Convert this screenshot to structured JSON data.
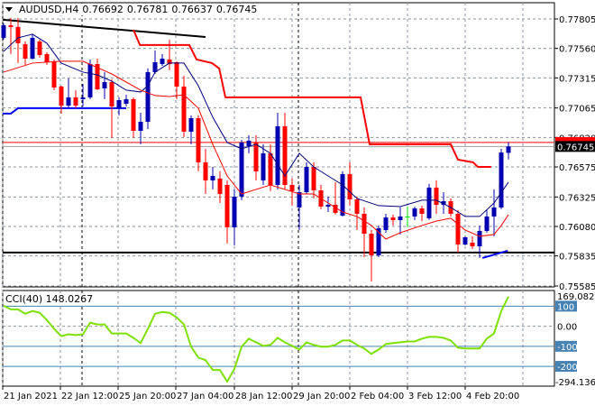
{
  "header": {
    "symbol": "AUDUSD,H4",
    "open": "0.76692",
    "high": "0.76781",
    "low": "0.76637",
    "close": "0.76745"
  },
  "cci_panel": {
    "label": "CCI(40) 148.0267"
  },
  "chart_data": [
    {
      "type": "candlestick",
      "symbol": "AUDUSD",
      "timeframe": "H4",
      "ylim": [
        0.75585,
        0.77805
      ],
      "y_ticks": [
        "0.77805",
        "0.77560",
        "0.77315",
        "0.77065",
        "0.76820",
        "0.76575",
        "0.76325",
        "0.76080",
        "0.75835",
        "0.75585"
      ],
      "x_tick_labels": [
        "21 Jan 2021",
        "22 Jan 12:00",
        "25 Jan 20:00",
        "27 Jan 04:00",
        "28 Jan 12:00",
        "29 Jan 20:00",
        "2 Feb 04:00",
        "3 Feb 12:00",
        "4 Feb 20:00"
      ],
      "current_price": "0.76745",
      "grid": true,
      "colors": {
        "bull": "#0000b0",
        "bear": "#ff0000",
        "doji": "#00e000",
        "ma_fast": "#000080",
        "ma_slow": "#ff0000",
        "channel_upper": "#ff0000",
        "channel_lower": "#0000ff",
        "trendline": "#000000",
        "cci": "#7fe000",
        "cci_level": "#4682b4",
        "price_label_bg": "#000000"
      },
      "ohlc": [
        [
          0.77648,
          0.77768,
          0.77633,
          0.77753
        ],
        [
          0.77753,
          0.77813,
          0.77513,
          0.77738
        ],
        [
          0.77738,
          0.77813,
          0.77438,
          0.77603
        ],
        [
          0.77595,
          0.77618,
          0.77423,
          0.77475
        ],
        [
          0.77475,
          0.77678,
          0.77468,
          0.77648
        ],
        [
          0.77618,
          0.77633,
          0.77483,
          0.77505
        ],
        [
          0.77513,
          0.77528,
          0.77423,
          0.77445
        ],
        [
          0.77453,
          0.77468,
          0.77213,
          0.77235
        ],
        [
          0.77243,
          0.7725,
          0.77018,
          0.77085
        ],
        [
          0.77085,
          0.7731,
          0.7707,
          0.77153
        ],
        [
          0.77153,
          0.77213,
          0.77063,
          0.77085
        ],
        [
          0.77138,
          0.77265,
          0.77078,
          0.77153
        ],
        [
          0.77153,
          0.77468,
          0.77138,
          0.7743
        ],
        [
          0.7743,
          0.77475,
          0.77213,
          0.7722
        ],
        [
          0.77228,
          0.77363,
          0.77138,
          0.7728
        ],
        [
          0.7728,
          0.77303,
          0.76815,
          0.77078
        ],
        [
          0.77063,
          0.77153,
          0.77003,
          0.7713
        ],
        [
          0.771,
          0.77175,
          0.77078,
          0.77138
        ],
        [
          0.77138,
          0.77153,
          0.76815,
          0.76875
        ],
        [
          0.76875,
          0.77025,
          0.76763,
          0.7695
        ],
        [
          0.7695,
          0.77393,
          0.7689,
          0.77363
        ],
        [
          0.77363,
          0.77543,
          0.77348,
          0.77445
        ],
        [
          0.7743,
          0.77513,
          0.77415,
          0.77475
        ],
        [
          0.77468,
          0.77633,
          0.77378,
          0.7743
        ],
        [
          0.77445,
          0.77453,
          0.77138,
          0.77243
        ],
        [
          0.77243,
          0.77333,
          0.76823,
          0.76868
        ],
        [
          0.76868,
          0.77003,
          0.76763,
          0.7698
        ],
        [
          0.7698,
          0.77003,
          0.76538,
          0.76613
        ],
        [
          0.76613,
          0.76725,
          0.7635,
          0.76463
        ],
        [
          0.76463,
          0.76575,
          0.76388,
          0.765
        ],
        [
          0.76478,
          0.76538,
          0.76275,
          0.7635
        ],
        [
          0.76425,
          0.76463,
          0.75938,
          0.76073
        ],
        [
          0.76073,
          0.76388,
          0.75923,
          0.76328
        ],
        [
          0.76328,
          0.768,
          0.76298,
          0.76778
        ],
        [
          0.76748,
          0.76838,
          0.76688,
          0.76793
        ],
        [
          0.76778,
          0.76838,
          0.76463,
          0.76538
        ],
        [
          0.76463,
          0.76763,
          0.76425,
          0.76688
        ],
        [
          0.76688,
          0.76763,
          0.76373,
          0.76425
        ],
        [
          0.76425,
          0.77025,
          0.76388,
          0.76913
        ],
        [
          0.76913,
          0.77025,
          0.76388,
          0.76425
        ],
        [
          0.76425,
          0.76478,
          0.76253,
          0.76373
        ],
        [
          0.76238,
          0.76425,
          0.7605,
          0.76365
        ],
        [
          0.76365,
          0.76613,
          0.7635,
          0.76575
        ],
        [
          0.76575,
          0.76613,
          0.76313,
          0.7638
        ],
        [
          0.7638,
          0.76425,
          0.76223,
          0.76245
        ],
        [
          0.76245,
          0.76328,
          0.762,
          0.7626
        ],
        [
          0.7626,
          0.76448,
          0.76178,
          0.76193
        ],
        [
          0.7617,
          0.76538,
          0.76163,
          0.76515
        ],
        [
          0.76515,
          0.76613,
          0.76253,
          0.76305
        ],
        [
          0.76305,
          0.76328,
          0.7605,
          0.76185
        ],
        [
          0.76185,
          0.76238,
          0.75825,
          0.7602
        ],
        [
          0.7602,
          0.7605,
          0.75623,
          0.7584
        ],
        [
          0.7584,
          0.76088,
          0.75825,
          0.76065
        ],
        [
          0.7605,
          0.76185,
          0.76028,
          0.76155
        ],
        [
          0.76155,
          0.76178,
          0.76088,
          0.76133
        ],
        [
          0.76133,
          0.76238,
          0.76013,
          0.76163
        ],
        [
          0.76163,
          0.76245,
          0.76073,
          0.76163
        ],
        [
          0.76163,
          0.76245,
          0.76133,
          0.7623
        ],
        [
          0.7623,
          0.76253,
          0.76125,
          0.76185
        ],
        [
          0.76148,
          0.76433,
          0.76133,
          0.76403
        ],
        [
          0.76403,
          0.76463,
          0.76185,
          0.7626
        ],
        [
          0.7626,
          0.76365,
          0.76185,
          0.7629
        ],
        [
          0.7629,
          0.76313,
          0.76163,
          0.76185
        ],
        [
          0.76185,
          0.76215,
          0.75863,
          0.7593
        ],
        [
          0.7593,
          0.75998,
          0.75923,
          0.7599
        ],
        [
          0.75945,
          0.75998,
          0.75893,
          0.75915
        ],
        [
          0.75915,
          0.76088,
          0.75818,
          0.76043
        ],
        [
          0.76043,
          0.76223,
          0.76028,
          0.76163
        ],
        [
          0.76163,
          0.76388,
          0.75998,
          0.76238
        ],
        [
          0.76238,
          0.76725,
          0.76223,
          0.76695
        ],
        [
          0.76692,
          0.76781,
          0.76637,
          0.76745
        ]
      ],
      "ma_fast": [
        [
          0,
          0.77535
        ],
        [
          2,
          0.77648
        ],
        [
          4,
          0.77678
        ],
        [
          6,
          0.77603
        ],
        [
          8,
          0.77438
        ],
        [
          11,
          0.77363
        ],
        [
          13,
          0.7734
        ],
        [
          15,
          0.77288
        ],
        [
          17,
          0.77213
        ],
        [
          19,
          0.77198
        ],
        [
          20,
          0.7725
        ],
        [
          21,
          0.77363
        ],
        [
          23,
          0.77438
        ],
        [
          25,
          0.77438
        ],
        [
          27,
          0.7725
        ],
        [
          29,
          0.76988
        ],
        [
          31,
          0.76778
        ],
        [
          33,
          0.76725
        ],
        [
          35,
          0.76763
        ],
        [
          37,
          0.76688
        ],
        [
          39,
          0.765
        ],
        [
          41,
          0.76688
        ],
        [
          43,
          0.76575
        ],
        [
          45,
          0.765
        ],
        [
          47,
          0.76425
        ],
        [
          49,
          0.76313
        ],
        [
          52,
          0.76253
        ],
        [
          55,
          0.76245
        ],
        [
          58,
          0.76298
        ],
        [
          60,
          0.76298
        ],
        [
          62,
          0.76238
        ],
        [
          64,
          0.76163
        ],
        [
          66,
          0.76163
        ],
        [
          68,
          0.76275
        ],
        [
          70,
          0.76448
        ]
      ],
      "ma_slow": [
        [
          0,
          0.77363
        ],
        [
          4,
          0.77438
        ],
        [
          8,
          0.77453
        ],
        [
          11,
          0.77453
        ],
        [
          15,
          0.77348
        ],
        [
          19,
          0.77213
        ],
        [
          21,
          0.77168
        ],
        [
          23,
          0.7716
        ],
        [
          25,
          0.77175
        ],
        [
          27,
          0.77063
        ],
        [
          29,
          0.76763
        ],
        [
          31,
          0.765
        ],
        [
          33,
          0.7635
        ],
        [
          35,
          0.76388
        ],
        [
          37,
          0.76425
        ],
        [
          39,
          0.76388
        ],
        [
          41,
          0.7635
        ],
        [
          43,
          0.7635
        ],
        [
          45,
          0.76275
        ],
        [
          47,
          0.762
        ],
        [
          49,
          0.76163
        ],
        [
          51,
          0.76088
        ],
        [
          53,
          0.75975
        ],
        [
          55,
          0.76028
        ],
        [
          58,
          0.76088
        ],
        [
          60,
          0.76125
        ],
        [
          62,
          0.76148
        ],
        [
          64,
          0.7605
        ],
        [
          66,
          0.75998
        ],
        [
          68,
          0.76013
        ],
        [
          69,
          0.76088
        ],
        [
          70,
          0.76178
        ]
      ],
      "channel_upper": [
        [
          18,
          0.77715
        ],
        [
          18.9,
          0.77588
        ],
        [
          25.75,
          0.77588
        ],
        [
          26.75,
          0.77468
        ],
        [
          28.9,
          0.77438
        ],
        [
          29.9,
          0.77393
        ],
        [
          30.75,
          0.77153
        ],
        [
          49.5,
          0.77153
        ],
        [
          50.75,
          0.76763
        ],
        [
          62,
          0.76763
        ],
        [
          63,
          0.76635
        ],
        [
          65.1,
          0.76613
        ],
        [
          65.75,
          0.76575
        ],
        [
          67.6,
          0.76575
        ]
      ],
      "channel_lower": [
        [
          -0.1,
          0.77018
        ],
        [
          1,
          0.77018
        ],
        [
          2,
          0.77063
        ],
        [
          17,
          0.77063
        ]
      ],
      "channel_lower_right": [
        [
          66.4,
          0.75818
        ],
        [
          69.9,
          0.75878
        ]
      ],
      "trendline": [
        [
          -0.1,
          0.77798
        ],
        [
          28,
          0.77655
        ]
      ],
      "support_level": 0.75863,
      "resistance_level": 0.76778
    },
    {
      "type": "line",
      "name": "CCI(40)",
      "ylim": [
        -294.1362,
        169.082
      ],
      "y_labels": {
        "top": "169.082",
        "bottom": "-294.1362",
        "zero": "0.00",
        "levels": [
          "100",
          "-100",
          "-200"
        ]
      },
      "levels": [
        100,
        0,
        -100,
        -200
      ],
      "values": [
        102,
        84,
        84,
        62,
        76,
        67,
        31,
        -13,
        -49,
        -40,
        -44,
        -40,
        18,
        9,
        9,
        -36,
        -36,
        -36,
        -58,
        -84,
        -13,
        62,
        71,
        67,
        44,
        9,
        -102,
        -156,
        -169,
        -218,
        -218,
        -276,
        -213,
        -102,
        -62,
        -80,
        -98,
        -93,
        -58,
        -80,
        -98,
        -116,
        -80,
        -93,
        -102,
        -102,
        -93,
        -71,
        -71,
        -93,
        -111,
        -138,
        -116,
        -89,
        -84,
        -80,
        -76,
        -76,
        -62,
        -53,
        -53,
        -58,
        -71,
        -107,
        -111,
        -111,
        -111,
        -62,
        -36,
        76,
        148.0267
      ]
    }
  ]
}
